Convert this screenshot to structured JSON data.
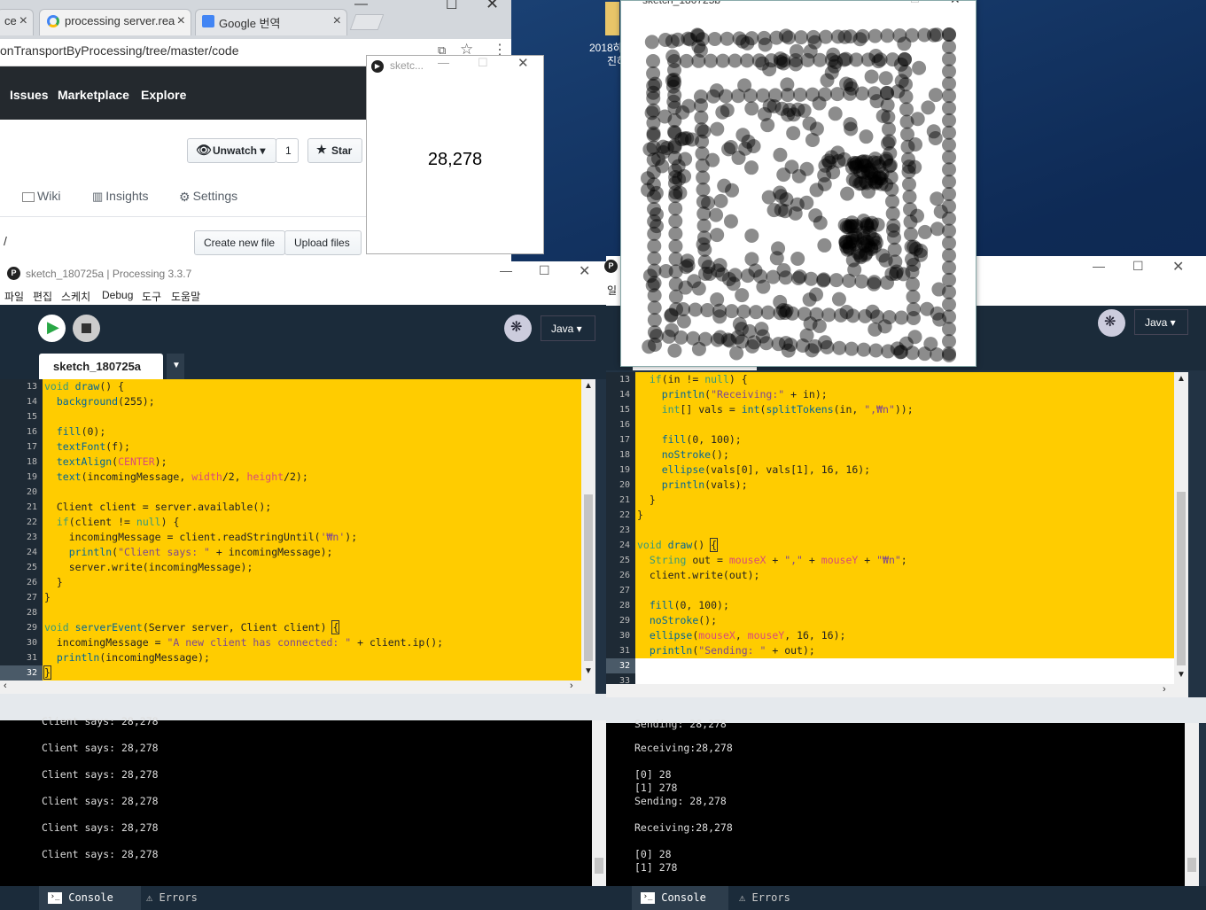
{
  "chrome": {
    "tabs": [
      {
        "label": "ce",
        "active": false
      },
      {
        "label": "processing server.rea",
        "active": true
      },
      {
        "label": "Google 번역",
        "active": false
      }
    ],
    "url": "onTransportByProcessing/tree/master/code",
    "nav": [
      "Issues",
      "Marketplace",
      "Explore"
    ],
    "unwatch_label": "Unwatch ▾",
    "watch_count": "1",
    "star_label": "Star",
    "tabs_row": [
      "Wiki",
      "Insights",
      "Settings"
    ],
    "path": "/",
    "create_file": "Create new file",
    "upload_files": "Upload files"
  },
  "small_sketch": {
    "title": "sketc...",
    "value": "28,278"
  },
  "desktop_icon": {
    "line1": "2018하",
    "line2": "진하"
  },
  "big_sketch": {
    "title": "sketch_180725b"
  },
  "left_ide": {
    "title": "sketch_180725a | Processing 3.3.7",
    "menu": [
      "파일",
      "편집",
      "스케치",
      "Debug",
      "도구",
      "도움말"
    ],
    "mode": "Java ▾",
    "tab": "sketch_180725a",
    "line_numbers": [
      "13",
      "14",
      "15",
      "16",
      "17",
      "18",
      "19",
      "20",
      "21",
      "22",
      "23",
      "24",
      "25",
      "26",
      "27",
      "28",
      "29",
      "30",
      "31",
      "32"
    ],
    "current_line": "32",
    "console": [
      "Client says: 28,278",
      "Client says: 28,278",
      "Client says: 28,278",
      "Client says: 28,278",
      "Client says: 28,278",
      "Client says: 28,278"
    ],
    "console_tab": "Console",
    "errors_tab": "Errors"
  },
  "right_ide": {
    "title_frag": "일",
    "mode": "Java ▾",
    "line_numbers": [
      "13",
      "14",
      "15",
      "16",
      "17",
      "18",
      "19",
      "20",
      "21",
      "22",
      "23",
      "24",
      "25",
      "26",
      "27",
      "28",
      "29",
      "30",
      "31",
      "32",
      "33"
    ],
    "current_line": "32",
    "console": [
      "Sending: 28,278",
      "Receiving:28,278",
      "[0] 28",
      "[1] 278",
      "Sending: 28,278",
      "Receiving:28,278",
      "[0] 28",
      "[1] 278"
    ],
    "console_tab": "Console",
    "errors_tab": "Errors"
  },
  "colors": {
    "editor_bg": "#ffcc00",
    "ide_dark": "#1b2b3a",
    "keyword": "#33997e",
    "function": "#006699",
    "string": "#7d4793"
  }
}
